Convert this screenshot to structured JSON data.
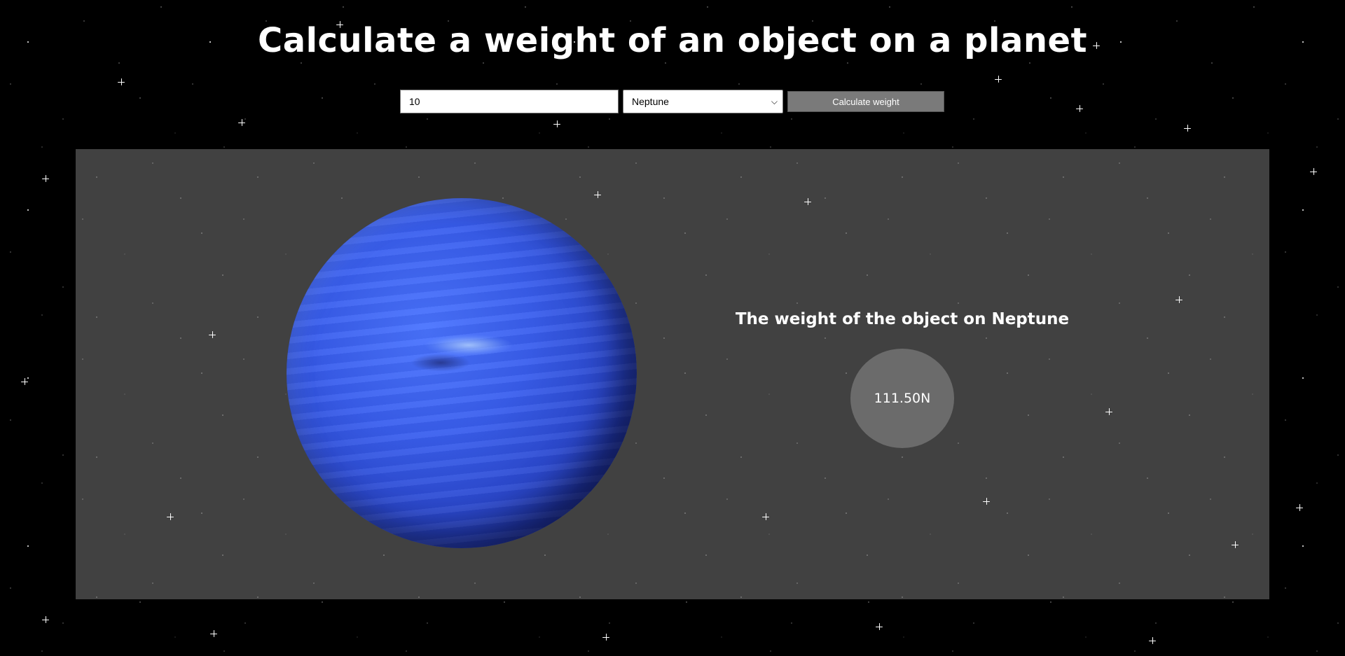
{
  "header": {
    "title": "Calculate a weight of an object on a planet"
  },
  "controls": {
    "mass_value": "10",
    "selected_planet": "Neptune",
    "calculate_label": "Calculate weight"
  },
  "result": {
    "heading": "The weight of the object on Neptune",
    "value": "111.50N"
  },
  "colors": {
    "background": "#000000",
    "panel": "#414141",
    "button": "#7a7a7a",
    "result_circle": "#6b6b6b",
    "planet_blue": "#3a5fee"
  },
  "icons": {
    "select_arrow": "chevron-down-icon",
    "planet": "neptune-planet-image"
  }
}
